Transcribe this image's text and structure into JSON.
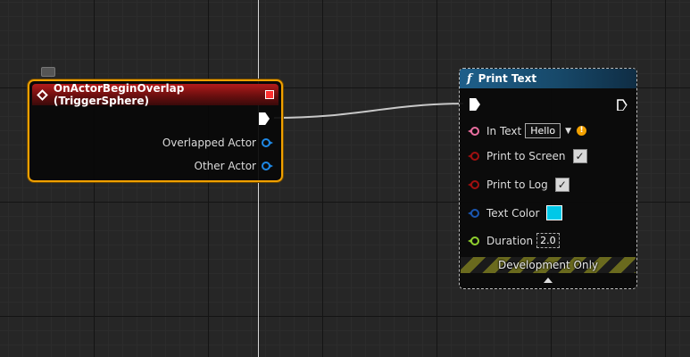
{
  "event_node": {
    "title": "OnActorBeginOverlap (TriggerSphere)",
    "outputs": [
      "Overlapped Actor",
      "Other Actor"
    ],
    "header_color": "#b31b1b",
    "border_color": "#f0a000"
  },
  "print_node": {
    "title": "Print Text",
    "func_icon": "f",
    "header_color": "#1e5f8a",
    "in_text": {
      "label": "In Text",
      "value": "Hello"
    },
    "print_to_screen": {
      "label": "Print to Screen",
      "checked": true
    },
    "print_to_log": {
      "label": "Print to Log",
      "checked": true
    },
    "text_color": {
      "label": "Text Color",
      "value": "#00c8e8"
    },
    "duration": {
      "label": "Duration",
      "value": "2.0"
    },
    "footer": "Development Only"
  }
}
